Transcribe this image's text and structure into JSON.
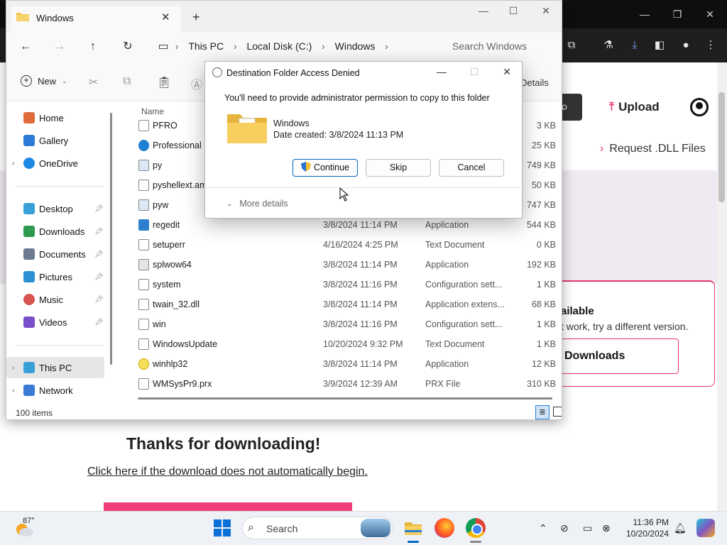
{
  "browser": {
    "title_controls": {
      "minimize": "—",
      "restore": "❐",
      "close": "✕"
    },
    "toolbar_icons": [
      "extensions-icon",
      "flask-icon",
      "download-icon",
      "sidebar-icon",
      "profile-icon",
      "menu-icon"
    ]
  },
  "website": {
    "upload_label": "Upload",
    "request_label": "Request .DLL Files",
    "card_title": "ailable",
    "card_text": "t work, try a different version.",
    "downloads_button": "Downloads",
    "thanks_heading": "Thanks for downloading!",
    "click_link": "Click here if the download does not automatically begin.",
    "accent_color": "#e7356e"
  },
  "explorer": {
    "tab_title": "Windows",
    "breadcrumb": [
      "This PC",
      "Local Disk (C:)",
      "Windows"
    ],
    "search_placeholder": "Search Windows",
    "new_label": "New",
    "details_label": "Details",
    "column_name": "Name",
    "nav": [
      {
        "label": "Home",
        "icon": "home-icon",
        "color": "#e06b3a"
      },
      {
        "label": "Gallery",
        "icon": "gallery-icon",
        "color": "#2b7bd6"
      },
      {
        "label": "OneDrive",
        "icon": "cloud-icon",
        "color": "#1e88e5"
      },
      {
        "label": "Desktop",
        "icon": "desktop-icon",
        "color": "#3aa0d8"
      },
      {
        "label": "Downloads",
        "icon": "download-icon",
        "color": "#2e9a4f"
      },
      {
        "label": "Documents",
        "icon": "document-icon",
        "color": "#6b7a8f"
      },
      {
        "label": "Pictures",
        "icon": "pictures-icon",
        "color": "#2b8fd6"
      },
      {
        "label": "Music",
        "icon": "music-icon",
        "color": "#d9534f"
      },
      {
        "label": "Videos",
        "icon": "video-icon",
        "color": "#7b4fc9"
      },
      {
        "label": "This PC",
        "icon": "computer-icon",
        "color": "#3aa0d8"
      },
      {
        "label": "Network",
        "icon": "network-icon",
        "color": "#3a7bd5"
      }
    ],
    "files": [
      {
        "name": "PFRO",
        "date": "",
        "type": "",
        "size": "3 KB"
      },
      {
        "name": "Professional",
        "date": "",
        "type": "",
        "size": "25 KB"
      },
      {
        "name": "py",
        "date": "",
        "type": "",
        "size": "749 KB"
      },
      {
        "name": "pyshellext.amd6",
        "date": "",
        "type": "",
        "size": "50 KB"
      },
      {
        "name": "pyw",
        "date": "",
        "type": "",
        "size": "747 KB"
      },
      {
        "name": "regedit",
        "date": "3/8/2024 11:14 PM",
        "type": "Application",
        "size": "544 KB"
      },
      {
        "name": "setuperr",
        "date": "4/16/2024 4:25 PM",
        "type": "Text Document",
        "size": "0 KB"
      },
      {
        "name": "splwow64",
        "date": "3/8/2024 11:14 PM",
        "type": "Application",
        "size": "192 KB"
      },
      {
        "name": "system",
        "date": "3/8/2024 11:16 PM",
        "type": "Configuration sett...",
        "size": "1 KB"
      },
      {
        "name": "twain_32.dll",
        "date": "3/8/2024 11:14 PM",
        "type": "Application extens...",
        "size": "68 KB"
      },
      {
        "name": "win",
        "date": "3/8/2024 11:16 PM",
        "type": "Configuration sett...",
        "size": "1 KB"
      },
      {
        "name": "WindowsUpdate",
        "date": "10/20/2024 9:32 PM",
        "type": "Text Document",
        "size": "1 KB"
      },
      {
        "name": "winhlp32",
        "date": "3/8/2024 11:14 PM",
        "type": "Application",
        "size": "12 KB"
      },
      {
        "name": "WMSysPr9.prx",
        "date": "3/9/2024 12:39 AM",
        "type": "PRX File",
        "size": "310 KB"
      }
    ],
    "status": "100 items"
  },
  "dialog": {
    "title": "Destination Folder Access Denied",
    "message": "You'll need to provide administrator permission to copy to this folder",
    "folder_name": "Windows",
    "folder_date": "Date created: 3/8/2024 11:13 PM",
    "continue_label": "Continue",
    "skip_label": "Skip",
    "cancel_label": "Cancel",
    "more_details_label": "More details"
  },
  "taskbar": {
    "weather_temp": "87°",
    "search_label": "Search",
    "time": "11:36 PM",
    "date": "10/20/2024"
  }
}
